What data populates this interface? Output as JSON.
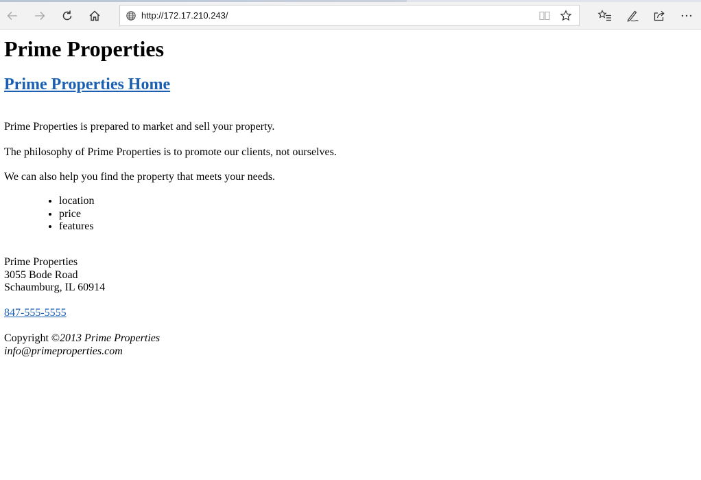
{
  "browser": {
    "url": "http://172.17.210.243/",
    "icons": [
      "back-icon",
      "forward-icon",
      "refresh-icon",
      "home-icon",
      "globe-icon",
      "reading-view-icon",
      "favorite-star-icon",
      "favorites-hub-icon",
      "pen-icon",
      "share-icon",
      "more-icon"
    ]
  },
  "page": {
    "title": "Prime Properties",
    "home_link": "Prime Properties Home",
    "para1": "Prime Properties is prepared to market and sell your property.",
    "para2": "The philosophy of Prime Properties is to promote our clients, not ourselves.",
    "para3": "We can also help you find the property that meets your needs.",
    "needs": [
      "location",
      "price",
      "features"
    ],
    "address": {
      "name": "Prime Properties",
      "street": "3055 Bode Road",
      "city": "Schaumburg, IL 60914"
    },
    "phone": "847-555-5555",
    "copyright_prefix": "Copyright ©",
    "copyright_italic": "2013 Prime Properties",
    "email": "info@primeproperties.com"
  }
}
